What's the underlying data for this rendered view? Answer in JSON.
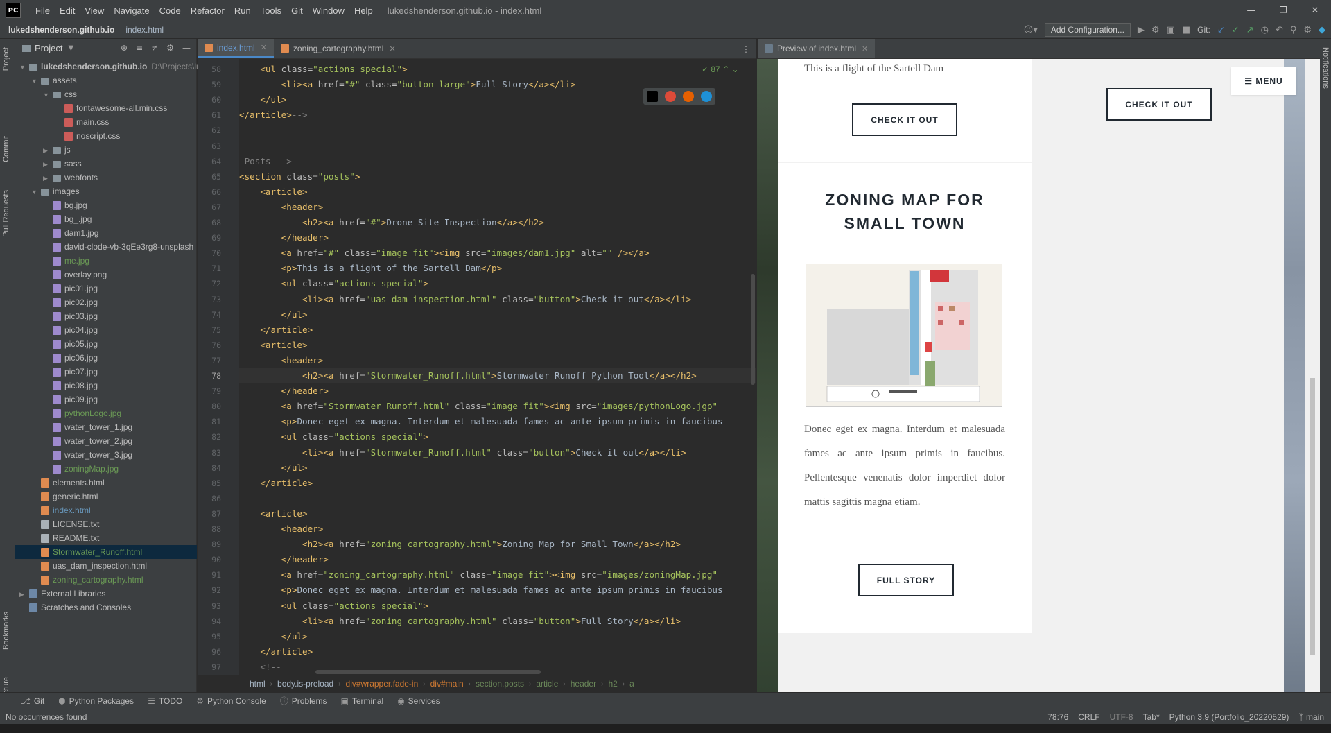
{
  "app": {
    "logo": "PC",
    "menu": [
      "File",
      "Edit",
      "View",
      "Navigate",
      "Code",
      "Refactor",
      "Run",
      "Tools",
      "Git",
      "Window",
      "Help"
    ],
    "window_title": "lukedshenderson.github.io - index.html"
  },
  "navbar": {
    "project": "lukedshenderson.github.io",
    "file": "index.html",
    "add_config": "Add Configuration...",
    "git_label": "Git:"
  },
  "left_stripe": {
    "project": "Project",
    "commit": "Commit",
    "pull_requests": "Pull Requests",
    "bookmarks": "Bookmarks",
    "structure": "Structure"
  },
  "right_stripe": {
    "notifications": "Notifications"
  },
  "project_panel": {
    "title": "Project",
    "tree": [
      {
        "label": "lukedshenderson.github.io",
        "suffix": "D:\\Projects\\lu",
        "depth": 0,
        "type": "folder",
        "open": true,
        "bold": true
      },
      {
        "label": "assets",
        "depth": 1,
        "type": "folder",
        "open": true
      },
      {
        "label": "css",
        "depth": 2,
        "type": "folder",
        "open": true
      },
      {
        "label": "fontawesome-all.min.css",
        "depth": 3,
        "type": "css"
      },
      {
        "label": "main.css",
        "depth": 3,
        "type": "css"
      },
      {
        "label": "noscript.css",
        "depth": 3,
        "type": "css"
      },
      {
        "label": "js",
        "depth": 2,
        "type": "folder",
        "open": false
      },
      {
        "label": "sass",
        "depth": 2,
        "type": "folder",
        "open": false
      },
      {
        "label": "webfonts",
        "depth": 2,
        "type": "folder",
        "open": false
      },
      {
        "label": "images",
        "depth": 1,
        "type": "folder",
        "open": true
      },
      {
        "label": "bg.jpg",
        "depth": 2,
        "type": "img"
      },
      {
        "label": "bg_.jpg",
        "depth": 2,
        "type": "img"
      },
      {
        "label": "dam1.jpg",
        "depth": 2,
        "type": "img"
      },
      {
        "label": "david-clode-vb-3qEe3rg8-unsplash",
        "depth": 2,
        "type": "img"
      },
      {
        "label": "me.jpg",
        "depth": 2,
        "type": "img",
        "color": "green"
      },
      {
        "label": "overlay.png",
        "depth": 2,
        "type": "img"
      },
      {
        "label": "pic01.jpg",
        "depth": 2,
        "type": "img"
      },
      {
        "label": "pic02.jpg",
        "depth": 2,
        "type": "img"
      },
      {
        "label": "pic03.jpg",
        "depth": 2,
        "type": "img"
      },
      {
        "label": "pic04.jpg",
        "depth": 2,
        "type": "img"
      },
      {
        "label": "pic05.jpg",
        "depth": 2,
        "type": "img"
      },
      {
        "label": "pic06.jpg",
        "depth": 2,
        "type": "img"
      },
      {
        "label": "pic07.jpg",
        "depth": 2,
        "type": "img"
      },
      {
        "label": "pic08.jpg",
        "depth": 2,
        "type": "img"
      },
      {
        "label": "pic09.jpg",
        "depth": 2,
        "type": "img"
      },
      {
        "label": "pythonLogo.jpg",
        "depth": 2,
        "type": "img",
        "color": "green"
      },
      {
        "label": "water_tower_1.jpg",
        "depth": 2,
        "type": "img"
      },
      {
        "label": "water_tower_2.jpg",
        "depth": 2,
        "type": "img"
      },
      {
        "label": "water_tower_3.jpg",
        "depth": 2,
        "type": "img"
      },
      {
        "label": "zoningMap.jpg",
        "depth": 2,
        "type": "img",
        "color": "green"
      },
      {
        "label": "elements.html",
        "depth": 1,
        "type": "html"
      },
      {
        "label": "generic.html",
        "depth": 1,
        "type": "html"
      },
      {
        "label": "index.html",
        "depth": 1,
        "type": "html",
        "color": "blue"
      },
      {
        "label": "LICENSE.txt",
        "depth": 1,
        "type": "txt"
      },
      {
        "label": "README.txt",
        "depth": 1,
        "type": "txt"
      },
      {
        "label": "Stormwater_Runoff.html",
        "depth": 1,
        "type": "html",
        "color": "green",
        "selected": true
      },
      {
        "label": "uas_dam_inspection.html",
        "depth": 1,
        "type": "html"
      },
      {
        "label": "zoning_cartography.html",
        "depth": 1,
        "type": "html",
        "color": "green"
      },
      {
        "label": "External Libraries",
        "depth": 0,
        "type": "lib",
        "open": false
      },
      {
        "label": "Scratches and Consoles",
        "depth": 0,
        "type": "lib",
        "noarrow": true
      }
    ]
  },
  "editor": {
    "tabs": [
      {
        "label": "index.html",
        "active": true
      },
      {
        "label": "zoning_cartography.html",
        "active": false
      }
    ],
    "inspection_count": "87",
    "current_line": 78,
    "lines": [
      {
        "n": 58,
        "text": "    <ul class=\"actions special\">"
      },
      {
        "n": 59,
        "text": "        <li><a href=\"#\" class=\"button large\">Full Story</a></li>"
      },
      {
        "n": 60,
        "text": "    </ul>"
      },
      {
        "n": 61,
        "text": "</article>-->"
      },
      {
        "n": 62,
        "text": ""
      },
      {
        "n": 63,
        "text": ""
      },
      {
        "n": 64,
        "text": " Posts -->"
      },
      {
        "n": 65,
        "text": "<section class=\"posts\">"
      },
      {
        "n": 66,
        "text": "    <article>"
      },
      {
        "n": 67,
        "text": "        <header>"
      },
      {
        "n": 68,
        "text": "            <h2><a href=\"#\">Drone Site Inspection</a></h2>"
      },
      {
        "n": 69,
        "text": "        </header>"
      },
      {
        "n": 70,
        "text": "        <a href=\"#\" class=\"image fit\"><img src=\"images/dam1.jpg\" alt=\"\" /></a>"
      },
      {
        "n": 71,
        "text": "        <p>This is a flight of the Sartell Dam</p>"
      },
      {
        "n": 72,
        "text": "        <ul class=\"actions special\">"
      },
      {
        "n": 73,
        "text": "            <li><a href=\"uas_dam_inspection.html\" class=\"button\">Check it out</a></li>"
      },
      {
        "n": 74,
        "text": "        </ul>"
      },
      {
        "n": 75,
        "text": "    </article>"
      },
      {
        "n": 76,
        "text": "    <article>"
      },
      {
        "n": 77,
        "text": "        <header>"
      },
      {
        "n": 78,
        "text": "            <h2><a href=\"Stormwater_Runoff.html\">Stormwater Runoff Python Tool</a></h2>"
      },
      {
        "n": 79,
        "text": "        </header>"
      },
      {
        "n": 80,
        "text": "        <a href=\"Stormwater_Runoff.html\" class=\"image fit\"><img src=\"images/pythonLogo.jgp\""
      },
      {
        "n": 81,
        "text": "        <p>Donec eget ex magna. Interdum et malesuada fames ac ante ipsum primis in faucibus"
      },
      {
        "n": 82,
        "text": "        <ul class=\"actions special\">"
      },
      {
        "n": 83,
        "text": "            <li><a href=\"Stormwater_Runoff.html\" class=\"button\">Check it out</a></li>"
      },
      {
        "n": 84,
        "text": "        </ul>"
      },
      {
        "n": 85,
        "text": "    </article>"
      },
      {
        "n": 86,
        "text": ""
      },
      {
        "n": 87,
        "text": "    <article>"
      },
      {
        "n": 88,
        "text": "        <header>"
      },
      {
        "n": 89,
        "text": "            <h2><a href=\"zoning_cartography.html\">Zoning Map for Small Town</a></h2>"
      },
      {
        "n": 90,
        "text": "        </header>"
      },
      {
        "n": 91,
        "text": "        <a href=\"zoning_cartography.html\" class=\"image fit\"><img src=\"images/zoningMap.jpg\""
      },
      {
        "n": 92,
        "text": "        <p>Donec eget ex magna. Interdum et malesuada fames ac ante ipsum primis in faucibus"
      },
      {
        "n": 93,
        "text": "        <ul class=\"actions special\">"
      },
      {
        "n": 94,
        "text": "            <li><a href=\"zoning_cartography.html\" class=\"button\">Full Story</a></li>"
      },
      {
        "n": 95,
        "text": "        </ul>"
      },
      {
        "n": 96,
        "text": "    </article>"
      },
      {
        "n": 97,
        "text": "    <!--"
      }
    ],
    "breadcrumb": [
      "html",
      "body.is-preload",
      "div#wrapper.fade-in",
      "div#main",
      "section.posts",
      "article",
      "header",
      "h2",
      "a"
    ]
  },
  "preview": {
    "tab": "Preview of index.html",
    "menu_label": "MENU",
    "card1_text": "This is a flight of the Sartell Dam",
    "card1_button": "CHECK IT OUT",
    "card2_button": "CHECK IT OUT",
    "card3_title_line1": "ZONING MAP FOR",
    "card3_title_line2": "SMALL TOWN",
    "card3_para": "Donec eget ex magna. Interdum et malesuada fames ac ante ipsum primis in faucibus. Pellentesque venenatis dolor imperdiet dolor mattis sagittis magna etiam.",
    "card3_button": "FULL STORY"
  },
  "bottom_toolbar": [
    "Git",
    "Python Packages",
    "TODO",
    "Python Console",
    "Problems",
    "Terminal",
    "Services"
  ],
  "status": {
    "message": "No occurrences found",
    "position": "78:76",
    "line_sep": "CRLF",
    "encoding": "UTF-8",
    "indent": "Tab*",
    "interpreter": "Python 3.9 (Portfolio_20220529)",
    "branch": "main"
  },
  "colors": {
    "tag": "#e8bf6a",
    "attr": "#bababa",
    "value": "#a5c25c",
    "comment": "#808080",
    "accent": "#4a88c7"
  }
}
